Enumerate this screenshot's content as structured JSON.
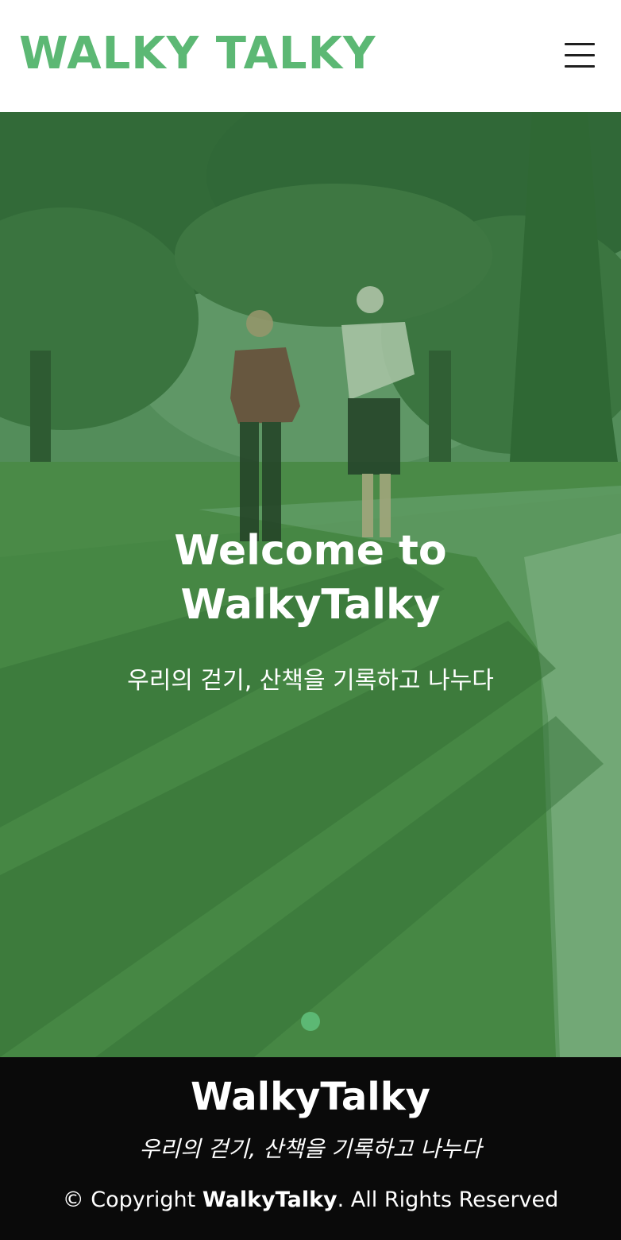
{
  "header": {
    "logo": "WALKY TALKY",
    "menu_icon": "hamburger-menu-icon"
  },
  "hero": {
    "title_line1": "Welcome to",
    "title_line2": "WalkyTalky",
    "subtitle": "우리의 걷기, 산책을 기록하고 나누다",
    "active_slide": 1,
    "slide_count": 1
  },
  "footer": {
    "brand": "WalkyTalky",
    "tagline": "우리의 걷기, 산책을 기록하고 나누다",
    "copyright_prefix": "© Copyright ",
    "copyright_brand": "WalkyTalky",
    "copyright_suffix": ". All Rights Reserved"
  },
  "colors": {
    "accent": "#5cb874",
    "header_bg": "#ffffff",
    "footer_bg": "#0a0a0a",
    "hero_tint": "#3f7a3e"
  }
}
